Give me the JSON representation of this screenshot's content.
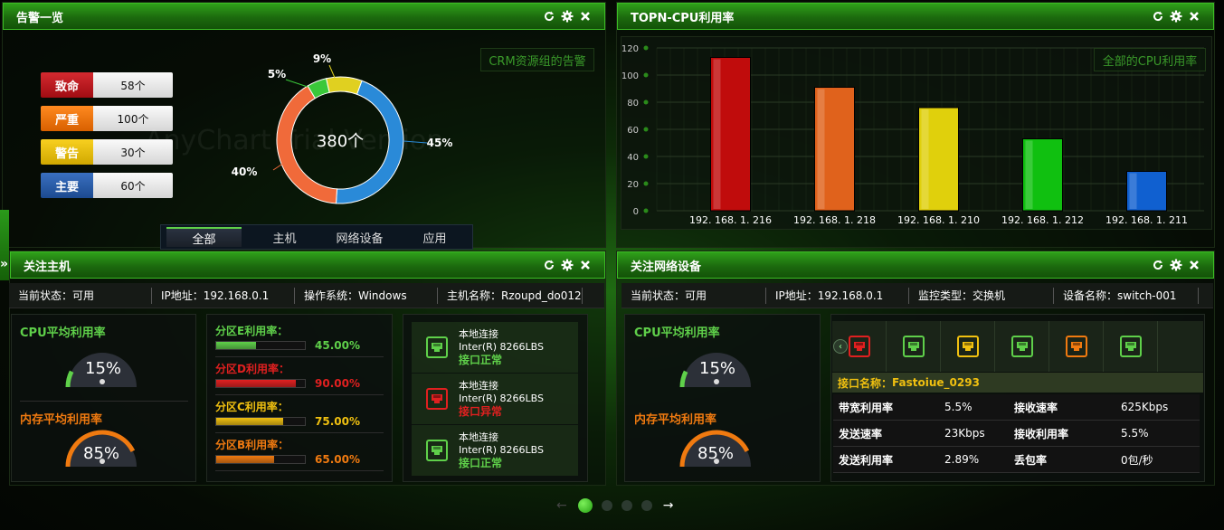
{
  "colors": {
    "critical": "#c0141c",
    "severe": "#f07a10",
    "warning": "#e8c000",
    "major": "#2a5faa",
    "green": "#5fd04a",
    "red": "#e02020",
    "orange": "#f07a10",
    "yellow": "#f0d010"
  },
  "alerts": {
    "title": "告警一览",
    "filter_button": "CRM资源组的告警",
    "legend": [
      {
        "label": "致命",
        "value": "58个"
      },
      {
        "label": "严重",
        "value": "100个"
      },
      {
        "label": "警告",
        "value": "30个"
      },
      {
        "label": "主要",
        "value": "60个"
      }
    ],
    "donut_total": "380个",
    "donut": [
      {
        "name": "slice-blue",
        "percent": 45,
        "label": "45%",
        "color": "#2a8ad8"
      },
      {
        "name": "slice-orange",
        "percent": 40,
        "label": "40%",
        "color": "#f06a3a"
      },
      {
        "name": "slice-green",
        "percent": 5,
        "label": "5%",
        "color": "#3ac83a"
      },
      {
        "name": "slice-yellow",
        "percent": 9,
        "label": "9%",
        "color": "#e0d020"
      }
    ],
    "tabs": [
      "全部",
      "主机",
      "网络设备",
      "应用"
    ],
    "watermark": "AnyChart Trial Version"
  },
  "cpu": {
    "title": "TOPN-CPU利用率",
    "filter_button": "全部的CPU利用率"
  },
  "chart_data": {
    "type": "bar",
    "categories": [
      "192.168.1.216",
      "192.168.1.218",
      "192.168.1.210",
      "192.168.1.212",
      "192.168.1.211"
    ],
    "category_labels": [
      "192. 168. 1. 216",
      "192. 168. 1. 218",
      "192. 168. 1. 210",
      "192. 168. 1. 212",
      "192. 168. 1. 211"
    ],
    "values": [
      113,
      91,
      76,
      53,
      29
    ],
    "colors": [
      "#c00c0c",
      "#e0621c",
      "#e0d00c",
      "#10c010",
      "#1060d0"
    ],
    "yticks": [
      0,
      20,
      40,
      60,
      80,
      100,
      120
    ],
    "ylim": [
      0,
      120
    ],
    "grid": true
  },
  "host": {
    "title": "关注主机",
    "info": [
      "当前状态：可用",
      "IP地址：192.168.0.1",
      "操作系统：Windows",
      "主机名称：Rzoupd_do012"
    ],
    "cpu_label": "CPU平均利用率",
    "cpu_value": "15%",
    "cpu_fraction": 0.15,
    "mem_label": "内存平均利用率",
    "mem_value": "85%",
    "mem_fraction": 0.85,
    "partitions": [
      {
        "label": "分区E利用率：",
        "pct": "45.00%",
        "fraction": 0.45,
        "color": "#5fd04a"
      },
      {
        "label": "分区D利用率：",
        "pct": "90.00%",
        "fraction": 0.9,
        "color": "#e02020"
      },
      {
        "label": "分区C利用率：",
        "pct": "75.00%",
        "fraction": 0.75,
        "color": "#f0c010"
      },
      {
        "label": "分区B利用率：",
        "pct": "65.00%",
        "fraction": 0.65,
        "color": "#f07a10"
      }
    ],
    "connections": [
      {
        "l1": "本地连接",
        "l2": "Inter(R) 8266LBS",
        "status": "接口正常",
        "color": "#5fd04a"
      },
      {
        "l1": "本地连接",
        "l2": "Inter(R) 8266LBS",
        "status": "接口异常",
        "color": "#e02020"
      },
      {
        "l1": "本地连接",
        "l2": "Inter(R) 8266LBS",
        "status": "接口正常",
        "color": "#5fd04a"
      }
    ]
  },
  "net": {
    "title": "关注网络设备",
    "info": [
      "当前状态：可用",
      "IP地址：192.168.0.1",
      "监控类型：交换机",
      "设备名称：switch-001"
    ],
    "cpu_label": "CPU平均利用率",
    "cpu_value": "15%",
    "cpu_fraction": 0.15,
    "mem_label": "内存平均利用率",
    "mem_value": "85%",
    "mem_fraction": 0.85,
    "port_colors": [
      "#e02020",
      "#5fd04a",
      "#f0c010",
      "#5fd04a",
      "#f07a10",
      "#5fd04a"
    ],
    "iface_name_label": "接口名称：",
    "iface_name": "Fastoiue_0293",
    "rows": [
      [
        "带宽利用率",
        "5.5%",
        "接收速率",
        "625Kbps"
      ],
      [
        "发送速率",
        "23Kbps",
        "接收利用率",
        "5.5%"
      ],
      [
        "发送利用率",
        "2.89%",
        "丢包率",
        "0包/秒"
      ]
    ]
  },
  "pager": {
    "count": 4,
    "active": 0
  }
}
